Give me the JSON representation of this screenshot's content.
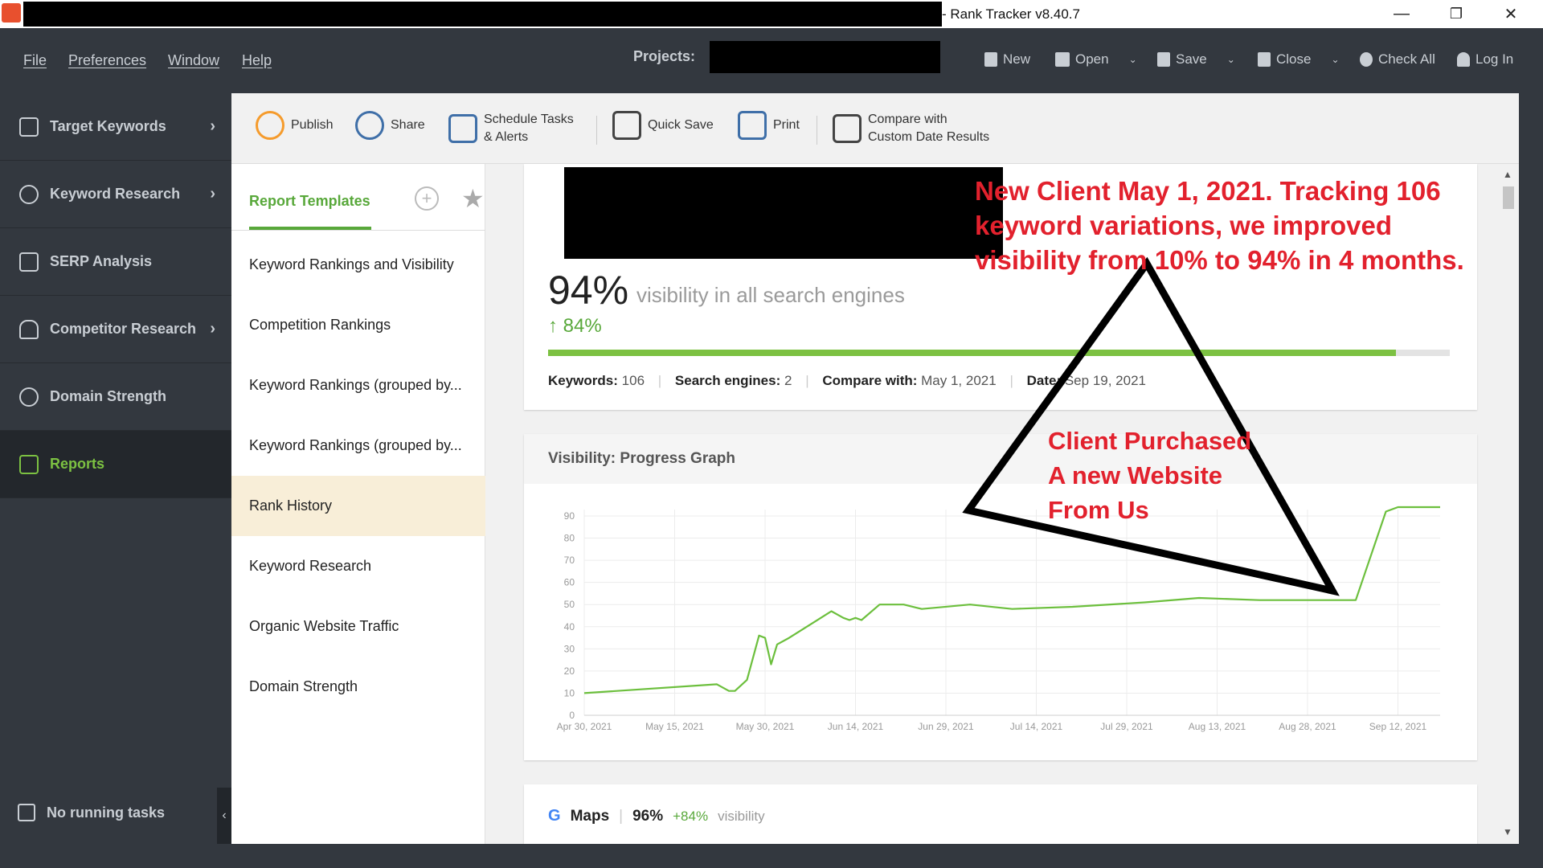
{
  "window": {
    "title": "- Rank Tracker v8.40.7",
    "minimize": "—",
    "restore": "❐",
    "close": "✕"
  },
  "menu": {
    "items": [
      "File",
      "Preferences",
      "Window",
      "Help"
    ],
    "projects_label": "Projects:",
    "actions": [
      {
        "label": "New",
        "icon": "new-file-icon"
      },
      {
        "label": "Open",
        "icon": "folder-icon",
        "dropdown": true
      },
      {
        "label": "Save",
        "icon": "save-icon",
        "dropdown": true
      },
      {
        "label": "Close",
        "icon": "close-box-icon",
        "dropdown": true
      },
      {
        "label": "Check All",
        "icon": "refresh-icon"
      },
      {
        "label": "Log In",
        "icon": "user-icon"
      }
    ]
  },
  "sidebar": {
    "items": [
      {
        "label": "Target Keywords",
        "icon": "trend-chart-icon",
        "chevron": "›"
      },
      {
        "label": "Keyword Research",
        "icon": "search-icon",
        "chevron": "›"
      },
      {
        "label": "SERP Analysis",
        "icon": "bar-chart-icon",
        "chevron": ""
      },
      {
        "label": "Competitor Research",
        "icon": "person-icon",
        "chevron": "›"
      },
      {
        "label": "Domain Strength",
        "icon": "gauge-icon",
        "chevron": ""
      },
      {
        "label": "Reports",
        "icon": "report-icon",
        "chevron": ""
      }
    ],
    "footer": "No running tasks",
    "collapse": "‹"
  },
  "toolbar": {
    "publish": "Publish",
    "share": "Share",
    "schedule_line1": "Schedule Tasks",
    "schedule_line2": "& Alerts",
    "quick_save": "Quick Save",
    "print": "Print",
    "compare_line1": "Compare with",
    "compare_line2": "Custom Date Results"
  },
  "templates": {
    "header": "Report Templates",
    "add": "+",
    "star": "★",
    "items": [
      "Keyword Rankings and Visibility",
      "Competition Rankings",
      "Keyword Rankings (grouped by...",
      "Keyword Rankings (grouped by...",
      "Rank History",
      "Keyword Research",
      "Organic Website Traffic",
      "Domain Strength"
    ],
    "selected_index": 4
  },
  "summary": {
    "visibility": "94%",
    "visibility_desc": "visibility in all search engines",
    "change": "↑ 84%",
    "progress_fraction": 0.94,
    "keywords_label": "Keywords:",
    "keywords_value": "106",
    "engines_label": "Search engines:",
    "engines_value": "2",
    "compare_label": "Compare with:",
    "compare_value": "May 1, 2021",
    "date_label": "Date:",
    "date_value": "Sep 19, 2021"
  },
  "graph": {
    "title": "Visibility: Progress Graph"
  },
  "maps": {
    "logo": "G",
    "label": "Maps",
    "visibility": "96%",
    "change": "+84%",
    "desc": "visibility"
  },
  "annotations": {
    "top_line1": "New Client May 1, 2021. Tracking 106",
    "top_line2": "keyword variations, we improved",
    "top_line3": "visibility from 10% to 94% in 4 months.",
    "mid_line1": "Client Purchased",
    "mid_line2": "A new Website",
    "mid_line3": "From Us"
  },
  "chart_data": {
    "type": "line",
    "title": "Visibility: Progress Graph",
    "ylim": [
      0,
      90
    ],
    "yticks": [
      0,
      10,
      20,
      30,
      40,
      50,
      60,
      70,
      80,
      90
    ],
    "xlim": [
      "2021-04-30",
      "2021-09-19"
    ],
    "xticks": [
      "Apr 30, 2021",
      "May 15, 2021",
      "May 30, 2021",
      "Jun 14, 2021",
      "Jun 29, 2021",
      "Jul 14, 2021",
      "Jul 29, 2021",
      "Aug 13, 2021",
      "Aug 28, 2021",
      "Sep 12, 2021"
    ],
    "grid": true,
    "series": [
      {
        "color": "#6cbf3d",
        "points": [
          [
            "2021-04-30",
            10
          ],
          [
            "2021-05-22",
            14
          ],
          [
            "2021-05-24",
            11
          ],
          [
            "2021-05-25",
            11
          ],
          [
            "2021-05-27",
            16
          ],
          [
            "2021-05-29",
            36
          ],
          [
            "2021-05-30",
            35
          ],
          [
            "2021-05-31",
            23
          ],
          [
            "2021-06-01",
            32
          ],
          [
            "2021-06-03",
            35
          ],
          [
            "2021-06-10",
            47
          ],
          [
            "2021-06-12",
            44
          ],
          [
            "2021-06-13",
            43
          ],
          [
            "2021-06-14",
            44
          ],
          [
            "2021-06-15",
            43
          ],
          [
            "2021-06-18",
            50
          ],
          [
            "2021-06-22",
            50
          ],
          [
            "2021-06-25",
            48
          ],
          [
            "2021-07-03",
            50
          ],
          [
            "2021-07-10",
            48
          ],
          [
            "2021-07-20",
            49
          ],
          [
            "2021-08-01",
            51
          ],
          [
            "2021-08-10",
            53
          ],
          [
            "2021-08-20",
            52
          ],
          [
            "2021-09-02",
            52
          ],
          [
            "2021-09-05",
            52
          ],
          [
            "2021-09-10",
            92
          ],
          [
            "2021-09-12",
            94
          ],
          [
            "2021-09-19",
            94
          ]
        ]
      }
    ]
  }
}
